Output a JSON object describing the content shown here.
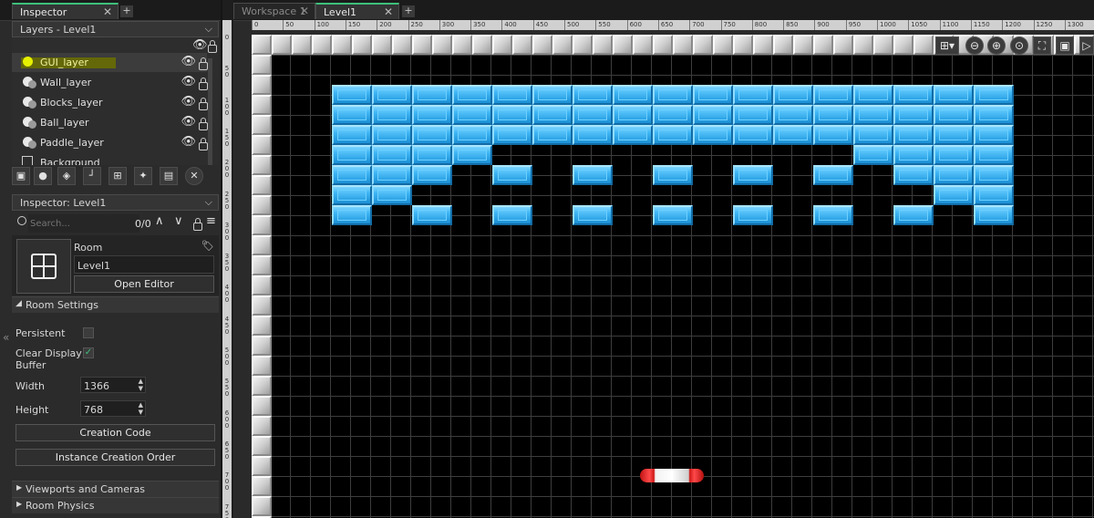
{
  "inspector_tab": {
    "label": "Inspector",
    "close": "✕",
    "add": "+"
  },
  "layers_header": {
    "title": "Layers - Level1",
    "chevron": "⌵"
  },
  "layers": [
    {
      "name": "GUI_layer",
      "selected": true
    },
    {
      "name": "Wall_layer"
    },
    {
      "name": "Blocks_layer"
    },
    {
      "name": "Ball_layer"
    },
    {
      "name": "Paddle_layer"
    },
    {
      "name": "Background"
    }
  ],
  "inspector_header": {
    "title": "Inspector: Level1",
    "chevron": "⌵"
  },
  "search": {
    "placeholder": "Search...",
    "count": "0/0"
  },
  "room": {
    "type_label": "Room",
    "name": "Level1",
    "open_editor": "Open Editor"
  },
  "room_settings": {
    "title": "Room Settings",
    "persistent_label": "Persistent",
    "clear_display_label_1": "Clear Display",
    "clear_display_label_2": "Buffer",
    "width_label": "Width",
    "width_value": "1366",
    "height_label": "Height",
    "height_value": "768",
    "creation_code": "Creation Code",
    "instance_order": "Instance Creation Order"
  },
  "sections": {
    "viewports": "Viewports and Cameras",
    "physics": "Room Physics"
  },
  "collapse_glyph": "«",
  "editor_tabs": [
    {
      "label": "Workspace 1",
      "close": "✕"
    },
    {
      "label": "Level1",
      "close": "✕"
    }
  ],
  "editor_add": "+",
  "ruler_h": [
    "0",
    "50",
    "100",
    "150",
    "200",
    "250",
    "300",
    "350",
    "400",
    "450",
    "500",
    "550",
    "600",
    "650",
    "700",
    "750",
    "800",
    "850",
    "900",
    "950",
    "1000",
    "1050",
    "1100",
    "1150",
    "1200",
    "1250",
    "1300"
  ],
  "ruler_v": [
    "0",
    "50",
    "100",
    "150",
    "200",
    "250",
    "300",
    "350",
    "400",
    "450",
    "500",
    "550",
    "600",
    "650",
    "700",
    "750"
  ],
  "colors": {
    "accent": "#3ec07a",
    "brick": "#3fb6f5",
    "paddle": "#d01818",
    "selection": "#c8e000"
  },
  "icons": [
    "eye-icon",
    "lock-icon",
    "search-icon",
    "grid-icon",
    "zoom-out-icon",
    "zoom-in-icon",
    "zoom-reset-icon",
    "fullscreen-icon",
    "play-icon"
  ]
}
